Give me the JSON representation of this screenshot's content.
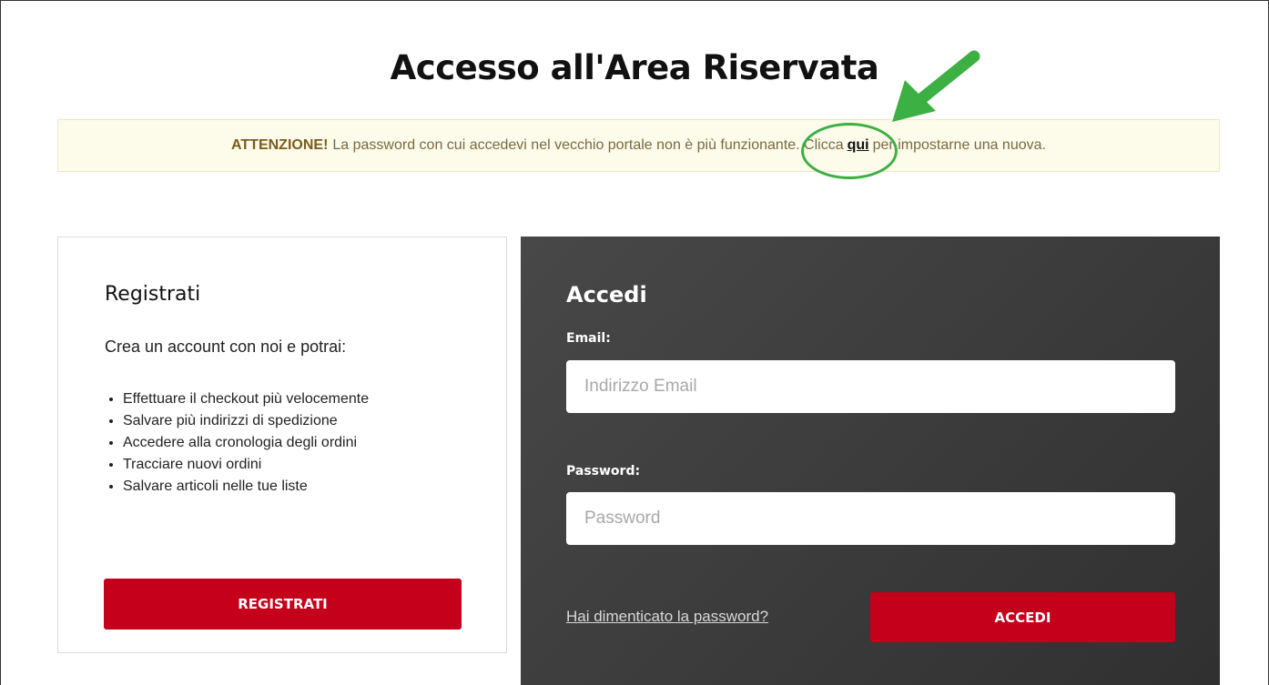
{
  "page": {
    "title": "Accesso all'Area Riservata"
  },
  "notice": {
    "strong": "ATTENZIONE!",
    "text_before": "La password con cui accedevi nel vecchio portale non è più funzionante. Clicca",
    "link": "qui",
    "text_after": "per impostarne una nuova."
  },
  "annotation": {
    "color": "#3cb043"
  },
  "register": {
    "title": "Registrati",
    "lead": "Crea un account con noi e potrai:",
    "benefits": [
      "Effettuare il checkout più velocemente",
      "Salvare più indirizzi di spedizione",
      "Accedere alla cronologia degli ordini",
      "Tracciare nuovi ordini",
      "Salvare articoli nelle tue liste"
    ],
    "button_label": "REGISTRATI"
  },
  "login": {
    "title": "Accedi",
    "email_label": "Email:",
    "email_placeholder": "Indirizzo Email",
    "email_value": "",
    "password_label": "Password:",
    "password_placeholder": "Password",
    "password_value": "",
    "forgot_link": "Hai dimenticato la password?",
    "button_label": "ACCEDI"
  },
  "colors": {
    "accent_red": "#c4001a",
    "notice_bg": "#fdfbe9",
    "dark_panel": "#3c3c3c"
  }
}
